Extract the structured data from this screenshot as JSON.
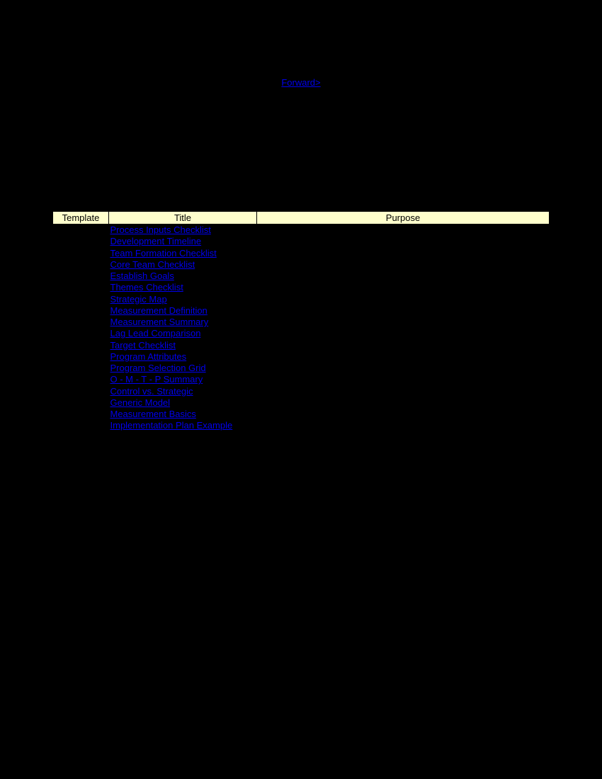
{
  "nav": {
    "forward": "Forward>"
  },
  "columns": {
    "template": "Template",
    "title": "Title",
    "purpose": "Purpose"
  },
  "rows": [
    {
      "title": "Process Inputs Checklist"
    },
    {
      "title": "Development Timeline"
    },
    {
      "title": "Team Formation Checklist"
    },
    {
      "title": "Core Team Checklist"
    },
    {
      "title": "Establish Goals"
    },
    {
      "title": "Themes Checklist"
    },
    {
      "title": "Strategic Map"
    },
    {
      "title": "Measurement Definition"
    },
    {
      "title": "Measurement Summary"
    },
    {
      "title": "Lag Lead Comparison"
    },
    {
      "title": "Target Checklist"
    },
    {
      "title": "Program Attributes"
    },
    {
      "title": "Program Selection Grid"
    },
    {
      "title": "O - M - T - P Summary"
    },
    {
      "title": "Control vs. Strategic"
    },
    {
      "title": "Generic Model"
    },
    {
      "title": "Measurement Basics"
    },
    {
      "title": "Implementation Plan Example"
    }
  ]
}
